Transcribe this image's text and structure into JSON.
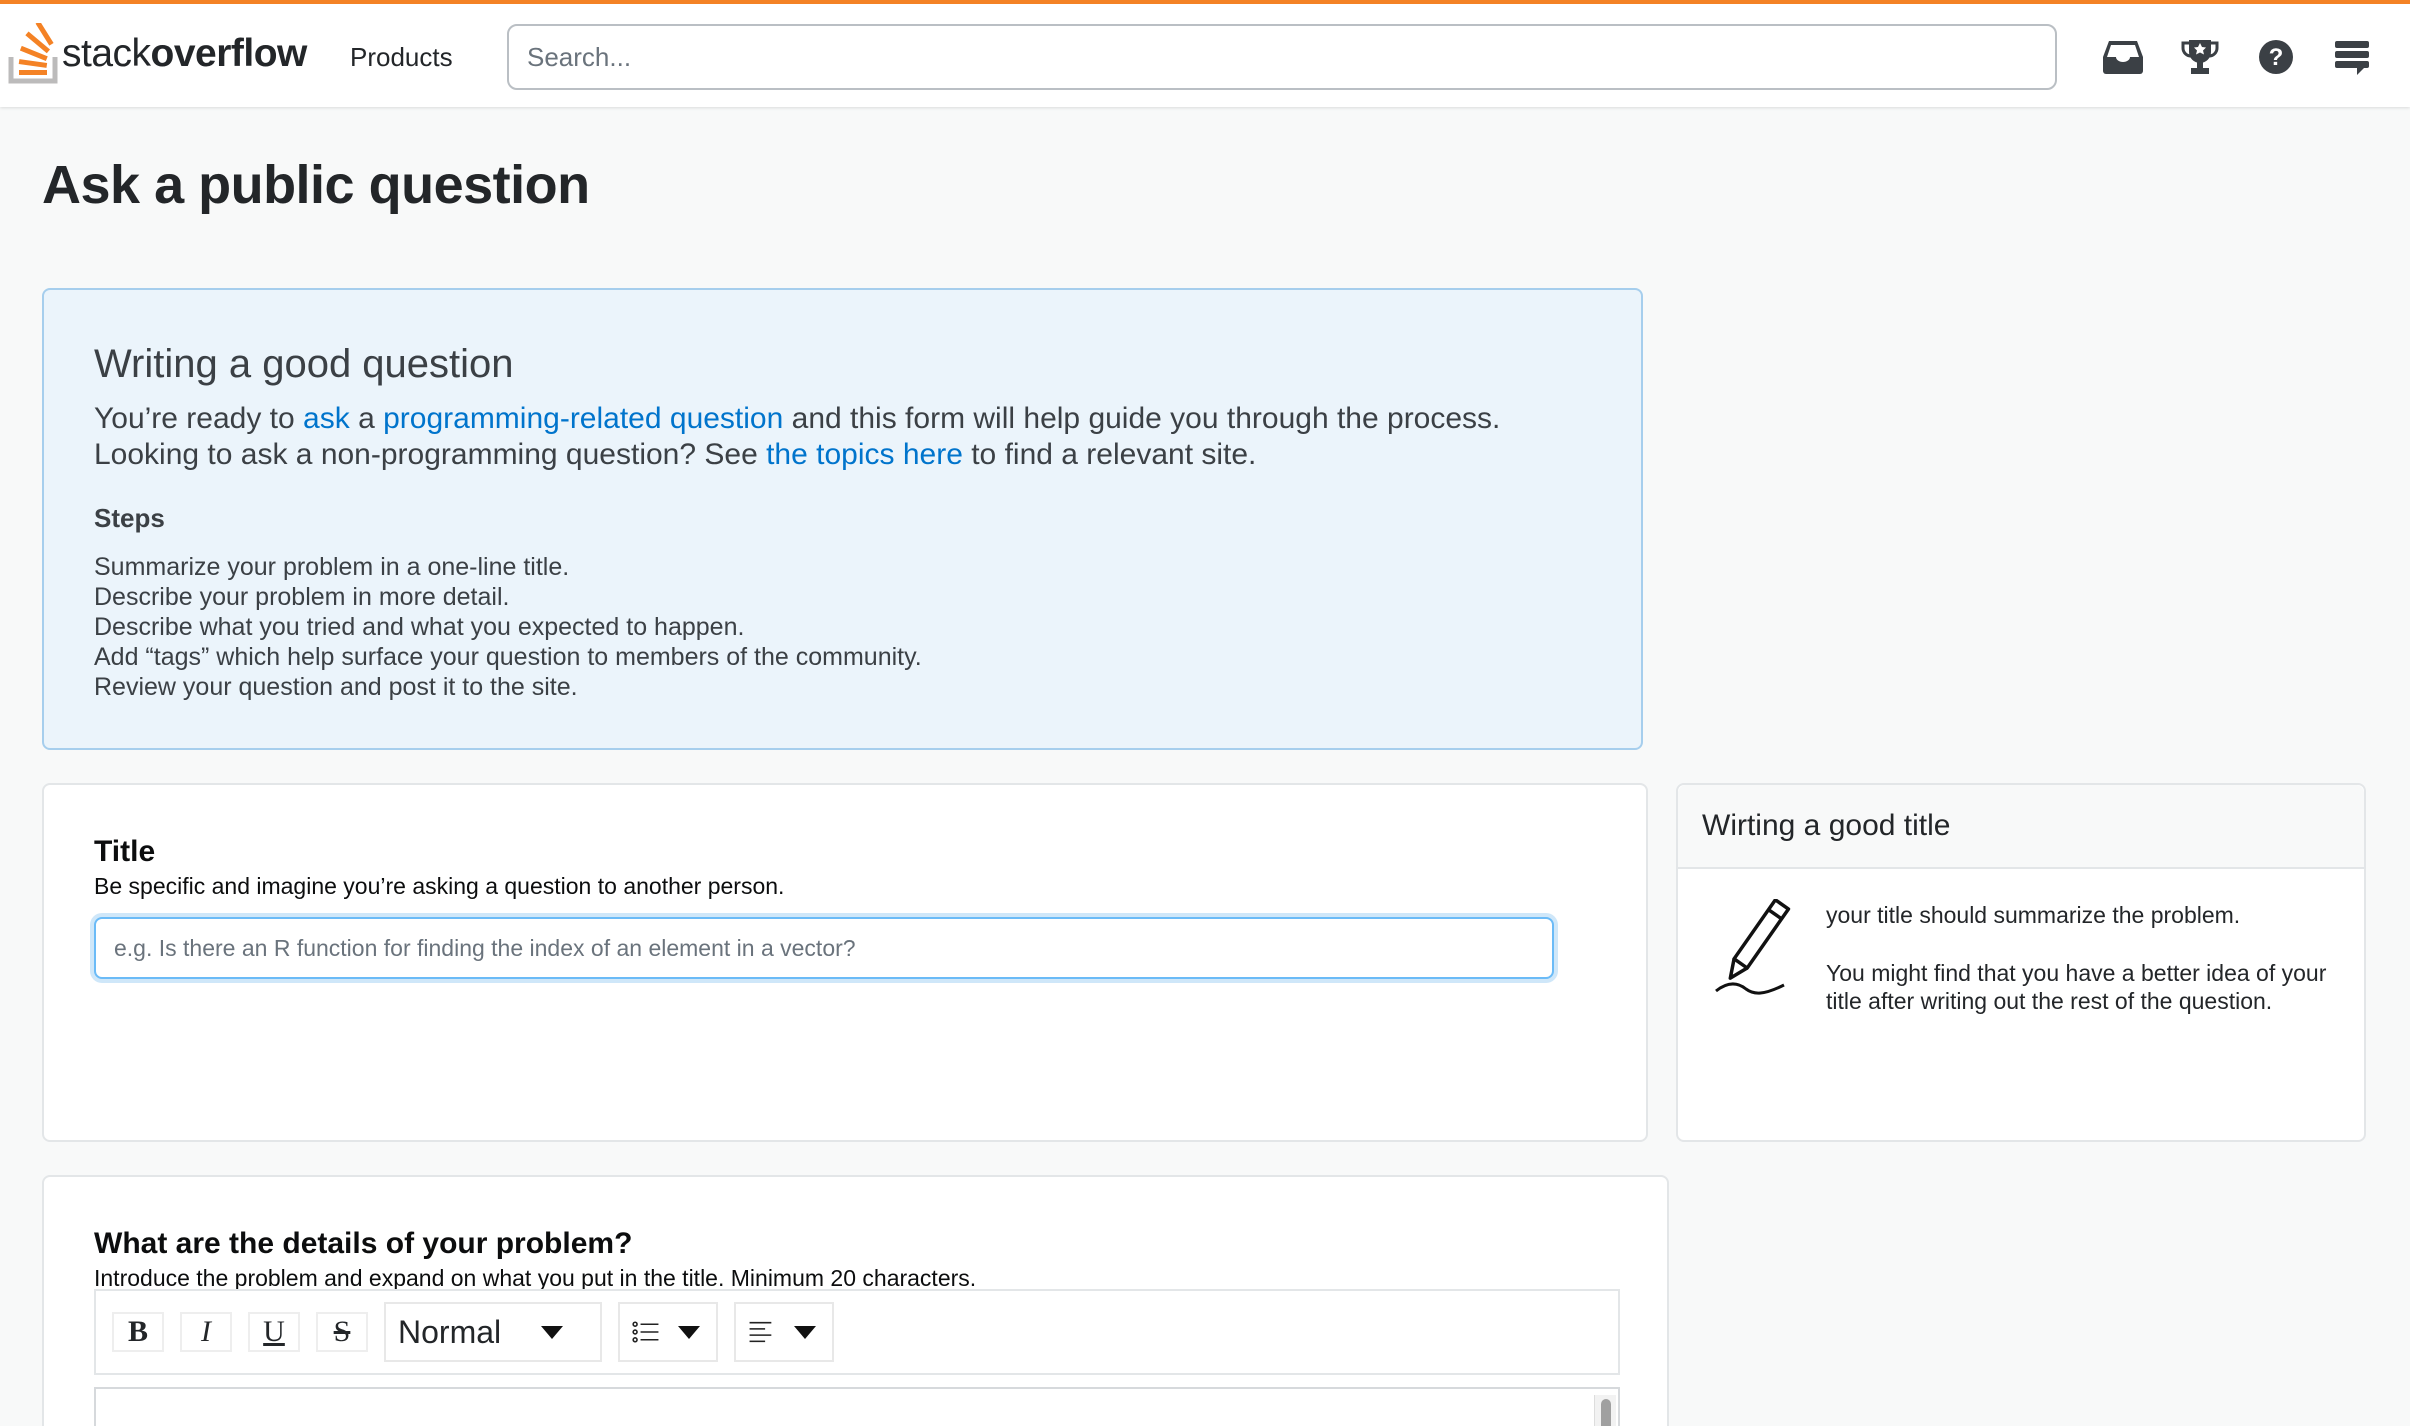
{
  "header": {
    "logo_light": "stack",
    "logo_bold": "overflow",
    "products_label": "Products",
    "search_placeholder": "Search...",
    "icons": [
      "inbox-icon",
      "achievements-icon",
      "help-icon",
      "site-switcher-icon"
    ]
  },
  "page": {
    "title": "Ask a public question"
  },
  "intro": {
    "heading": "Writing a good question",
    "line1_part1": "You’re ready to ",
    "link_ask": "ask",
    "line1_part2": " a ",
    "link_programming": "programming-related question",
    "line1_part3": " and this form will help guide you through the process.",
    "line2_part1": "Looking to ask a non-programming question? See ",
    "link_topics": "the topics here",
    "line2_part2": " to find a relevant site.",
    "steps_heading": "Steps",
    "steps": [
      "Summarize your problem in a one-line title.",
      "Describe your problem in more detail.",
      "Describe what you tried and what you expected to happen.",
      "Add “tags” which help surface your question to members of the community.",
      "Review your question and post it to the site."
    ]
  },
  "title_section": {
    "label": "Title",
    "description": "Be specific and imagine you’re asking a question to another person.",
    "input_placeholder": "e.g. Is there an R function for finding the index of an element in a vector?",
    "input_value": ""
  },
  "sidebar": {
    "heading": "Wirting a good title",
    "icon": "pencil-icon",
    "para1": "your title should summarize the problem.",
    "para2": "You might find that you have a better idea of your title after writing out the rest of the question."
  },
  "details_section": {
    "label": "What are the details of your problem?",
    "description": "Introduce the problem and expand on what you put in the title. Minimum 20 characters.",
    "toolbar": {
      "bold": "B",
      "italic": "I",
      "underline": "U",
      "strike": "S",
      "format_value": "Normal"
    }
  },
  "colors": {
    "accent": "#f48225",
    "link": "#0074cc",
    "notice_bg": "#ebf4fb",
    "notice_border": "#a6ceed"
  }
}
